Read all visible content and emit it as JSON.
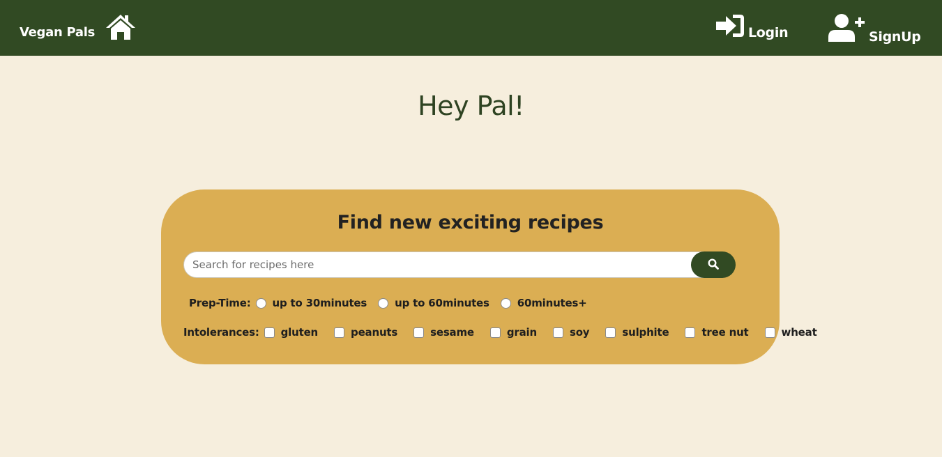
{
  "navbar": {
    "brand": "Vegan Pals",
    "home_icon": "home-icon",
    "login_label": "Login",
    "login_icon": "sign-in-icon",
    "signup_label": "SignUp",
    "signup_icon": "user-plus-icon"
  },
  "hero": {
    "title": "Hey Pal!"
  },
  "search": {
    "title": "Find new exciting recipes",
    "placeholder": "Search for recipes here",
    "value": "",
    "button_icon": "search-icon",
    "prep_time": {
      "label": "Prep-Time:",
      "options": [
        "up to 30minutes",
        "up to 60minutes",
        "60minutes+"
      ],
      "selected": null
    },
    "intolerances": {
      "label": "Intolerances:",
      "options": [
        "gluten",
        "peanuts",
        "sesame",
        "grain",
        "soy",
        "sulphite",
        "tree nut",
        "wheat"
      ],
      "checked": []
    }
  },
  "colors": {
    "navbar": "#314a23",
    "background": "#f6eedd",
    "card": "#dbae53",
    "title": "#2e4322"
  }
}
